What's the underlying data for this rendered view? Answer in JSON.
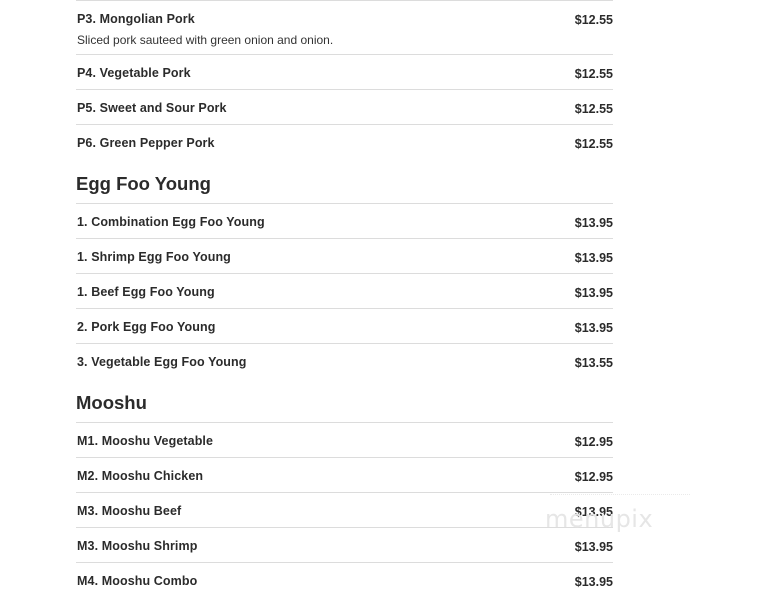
{
  "pork": [
    {
      "name": "P3. Mongolian Pork",
      "price": "$12.55",
      "description": "Sliced pork sauteed with green onion and onion."
    },
    {
      "name": "P4. Vegetable Pork",
      "price": "$12.55"
    },
    {
      "name": "P5. Sweet and Sour Pork",
      "price": "$12.55"
    },
    {
      "name": "P6. Green Pepper Pork",
      "price": "$12.55"
    }
  ],
  "egg_foo_young": {
    "title": "Egg Foo Young",
    "items": [
      {
        "name": "1. Combination Egg Foo Young",
        "price": "$13.95"
      },
      {
        "name": "1. Shrimp Egg Foo Young",
        "price": "$13.95"
      },
      {
        "name": "1. Beef Egg Foo Young",
        "price": "$13.95"
      },
      {
        "name": "2. Pork Egg Foo Young",
        "price": "$13.95"
      },
      {
        "name": "3. Vegetable Egg Foo Young",
        "price": "$13.55"
      }
    ]
  },
  "mooshu": {
    "title": "Mooshu",
    "items": [
      {
        "name": "M1. Mooshu Vegetable",
        "price": "$12.95"
      },
      {
        "name": "M2. Mooshu Chicken",
        "price": "$12.95"
      },
      {
        "name": "M3. Mooshu Beef",
        "price": "$13.95"
      },
      {
        "name": "M3. Mooshu Shrimp",
        "price": "$13.95"
      },
      {
        "name": "M4. Mooshu Combo",
        "price": "$13.95"
      }
    ]
  },
  "watermark": "menupix"
}
